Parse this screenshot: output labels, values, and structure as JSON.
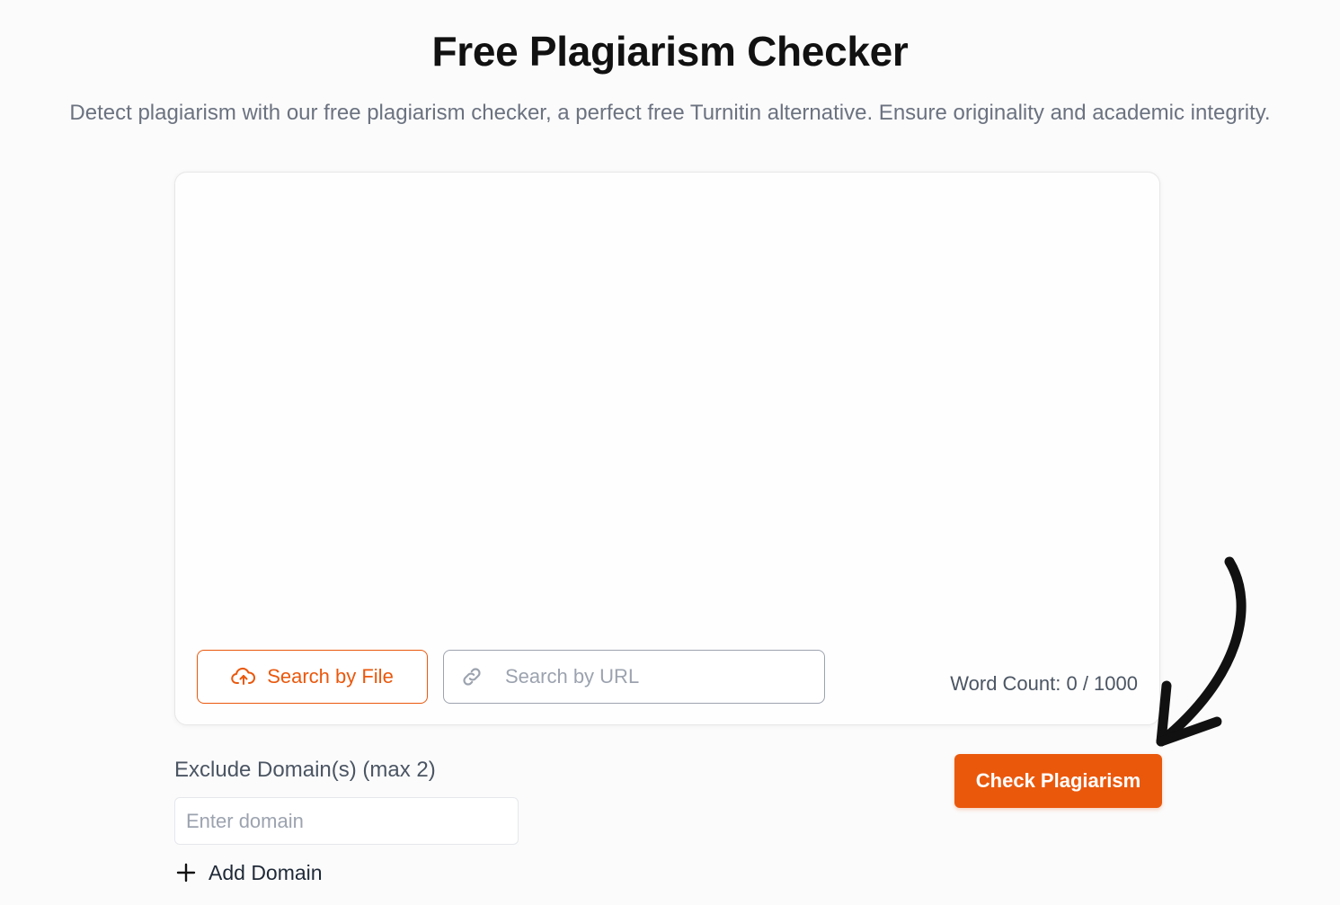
{
  "header": {
    "title": "Free Plagiarism Checker",
    "subtitle": "Detect plagiarism with our free plagiarism checker, a perfect free Turnitin alternative. Ensure originality and academic integrity."
  },
  "editor": {
    "text_value": "",
    "search_file_label": "Search by File",
    "search_file_icon": "cloud-upload-icon",
    "search_url_placeholder": "Search by URL",
    "search_url_icon": "link-icon",
    "word_count_text": "Word Count: 0 / 1000"
  },
  "exclude": {
    "label": "Exclude Domain(s) (max 2)",
    "domain_placeholder": "Enter domain",
    "add_domain_label": "Add Domain",
    "add_icon": "plus-icon"
  },
  "actions": {
    "check_label": "Check Plagiarism"
  },
  "colors": {
    "accent": "#ea580c",
    "background": "#fbfbfb",
    "muted_text": "#6b7280"
  },
  "annotation": {
    "icon": "curved-arrow-icon"
  }
}
